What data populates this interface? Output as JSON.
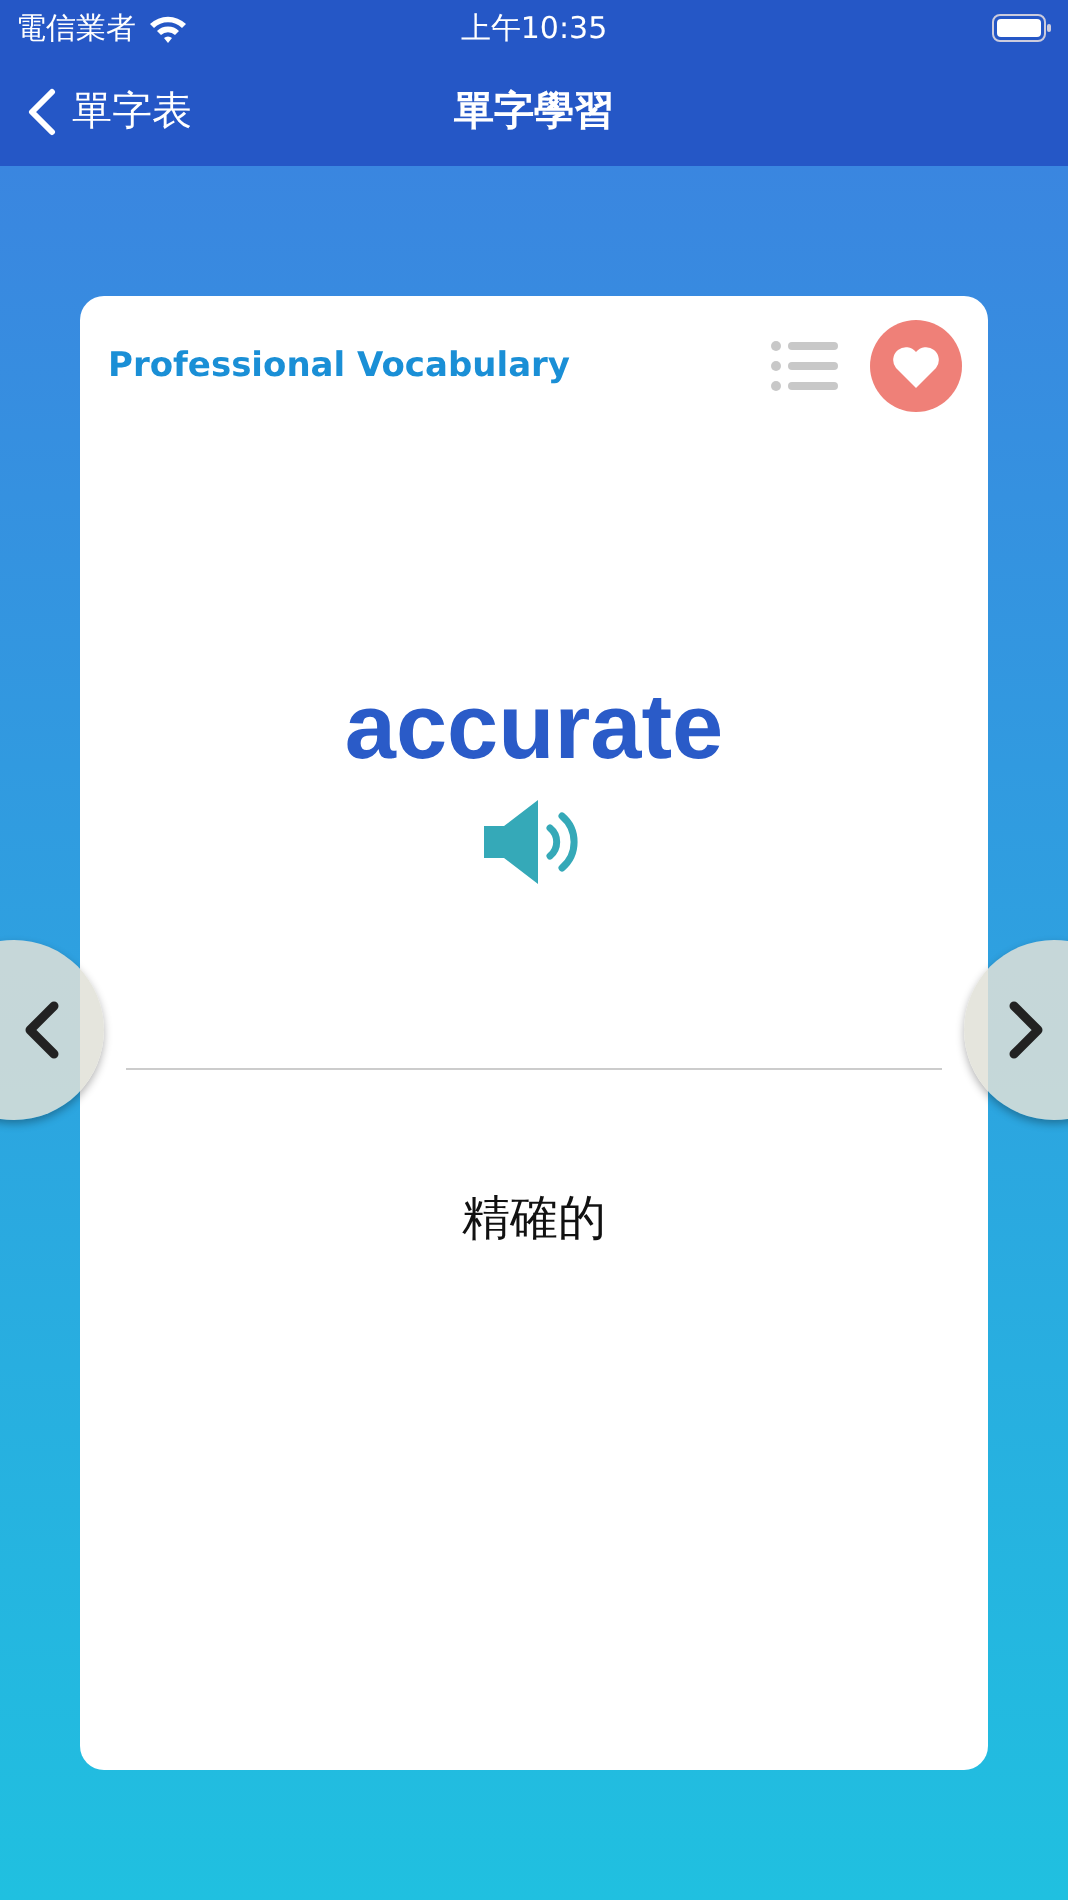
{
  "status_bar": {
    "carrier": "電信業者",
    "time": "上午10:35"
  },
  "nav": {
    "back_label": "單字表",
    "title": "單字學習"
  },
  "card": {
    "category": "Professional Vocabulary",
    "favorite": true,
    "word": "accurate",
    "translation": "精確的"
  }
}
